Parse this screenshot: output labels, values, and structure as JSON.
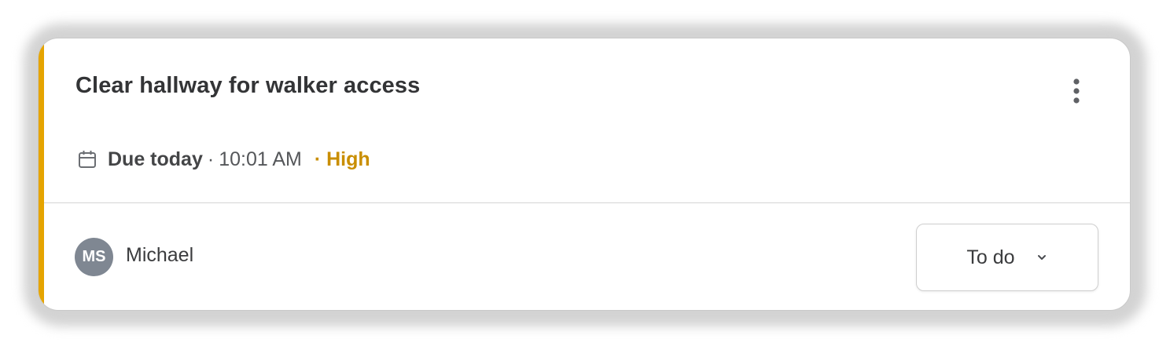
{
  "task": {
    "title": "Clear hallway for walker access",
    "due_label": "Due today",
    "separator": "·",
    "due_time": "10:01 AM",
    "priority": "· High",
    "assignee_initials": "MS",
    "assignee_name": "Michael",
    "status": "To do"
  },
  "colors": {
    "accent": "#e5a400",
    "priority_text": "#c98e00",
    "avatar_bg": "#7f8792",
    "text_primary": "#333436"
  },
  "icons": {
    "menu": "kebab-menu-icon",
    "calendar": "calendar-icon",
    "dropdown": "chevron-down-icon"
  }
}
